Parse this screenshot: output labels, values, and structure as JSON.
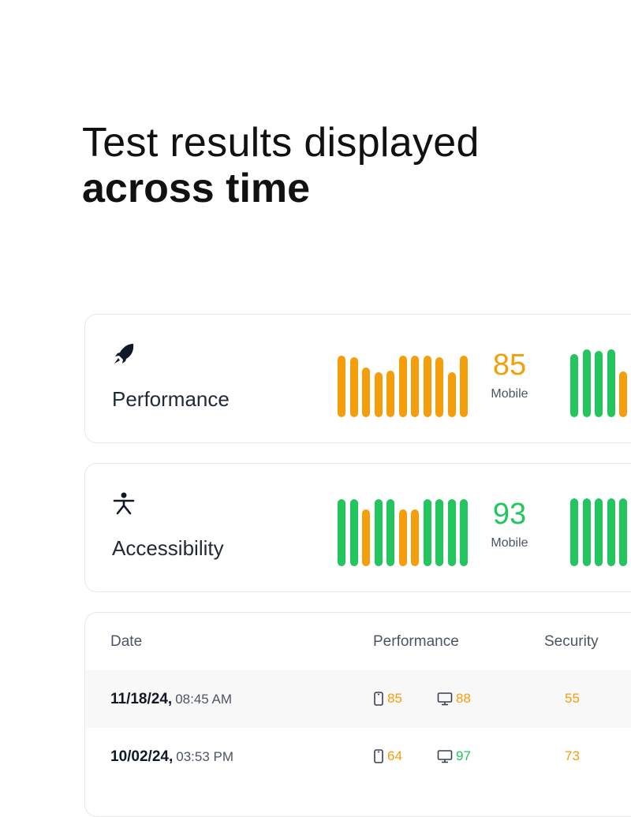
{
  "headline": {
    "line1": "Test results displayed",
    "line2": "across time"
  },
  "colors": {
    "orange": "#f59e0b",
    "green": "#22c55e"
  },
  "cards": [
    {
      "label": "Performance",
      "icon": "rocket-icon",
      "score": "85",
      "score_color": "orange",
      "device": "Mobile",
      "mobile_bars": [
        {
          "value": 0.98,
          "color": "orange"
        },
        {
          "value": 0.95,
          "color": "orange"
        },
        {
          "value": 0.79,
          "color": "orange"
        },
        {
          "value": 0.71,
          "color": "orange"
        },
        {
          "value": 0.74,
          "color": "orange"
        },
        {
          "value": 0.98,
          "color": "orange"
        },
        {
          "value": 0.98,
          "color": "orange"
        },
        {
          "value": 0.98,
          "color": "orange"
        },
        {
          "value": 0.95,
          "color": "orange"
        },
        {
          "value": 0.71,
          "color": "orange"
        },
        {
          "value": 0.98,
          "color": "orange"
        }
      ],
      "desktop_bars": [
        {
          "value": 1.0,
          "color": "green"
        },
        {
          "value": 1.08,
          "color": "green"
        },
        {
          "value": 1.05,
          "color": "green"
        },
        {
          "value": 1.08,
          "color": "green"
        },
        {
          "value": 0.72,
          "color": "orange"
        }
      ]
    },
    {
      "label": "Accessibility",
      "icon": "accessibility-icon",
      "score": "93",
      "score_color": "green",
      "device": "Mobile",
      "mobile_bars": [
        {
          "value": 1.06,
          "color": "green"
        },
        {
          "value": 1.06,
          "color": "green"
        },
        {
          "value": 0.9,
          "color": "orange"
        },
        {
          "value": 1.06,
          "color": "green"
        },
        {
          "value": 1.06,
          "color": "green"
        },
        {
          "value": 0.9,
          "color": "orange"
        },
        {
          "value": 0.9,
          "color": "orange"
        },
        {
          "value": 1.06,
          "color": "green"
        },
        {
          "value": 1.06,
          "color": "green"
        },
        {
          "value": 1.06,
          "color": "green"
        },
        {
          "value": 1.06,
          "color": "green"
        }
      ],
      "desktop_bars": [
        {
          "value": 1.08,
          "color": "green"
        },
        {
          "value": 1.08,
          "color": "green"
        },
        {
          "value": 1.08,
          "color": "green"
        },
        {
          "value": 1.08,
          "color": "green"
        },
        {
          "value": 1.08,
          "color": "green"
        }
      ]
    }
  ],
  "table": {
    "headers": {
      "date": "Date",
      "performance": "Performance",
      "security": "Security"
    },
    "rows": [
      {
        "date": "11/18/24,",
        "time": "08:45 AM",
        "mobile": "85",
        "mobile_color": "orange",
        "desktop": "88",
        "desktop_color": "orange",
        "security": "55",
        "security_color": "orange"
      },
      {
        "date": "10/02/24,",
        "time": "03:53 PM",
        "mobile": "64",
        "mobile_color": "orange",
        "desktop": "97",
        "desktop_color": "green",
        "security": "73",
        "security_color": "orange"
      }
    ]
  }
}
